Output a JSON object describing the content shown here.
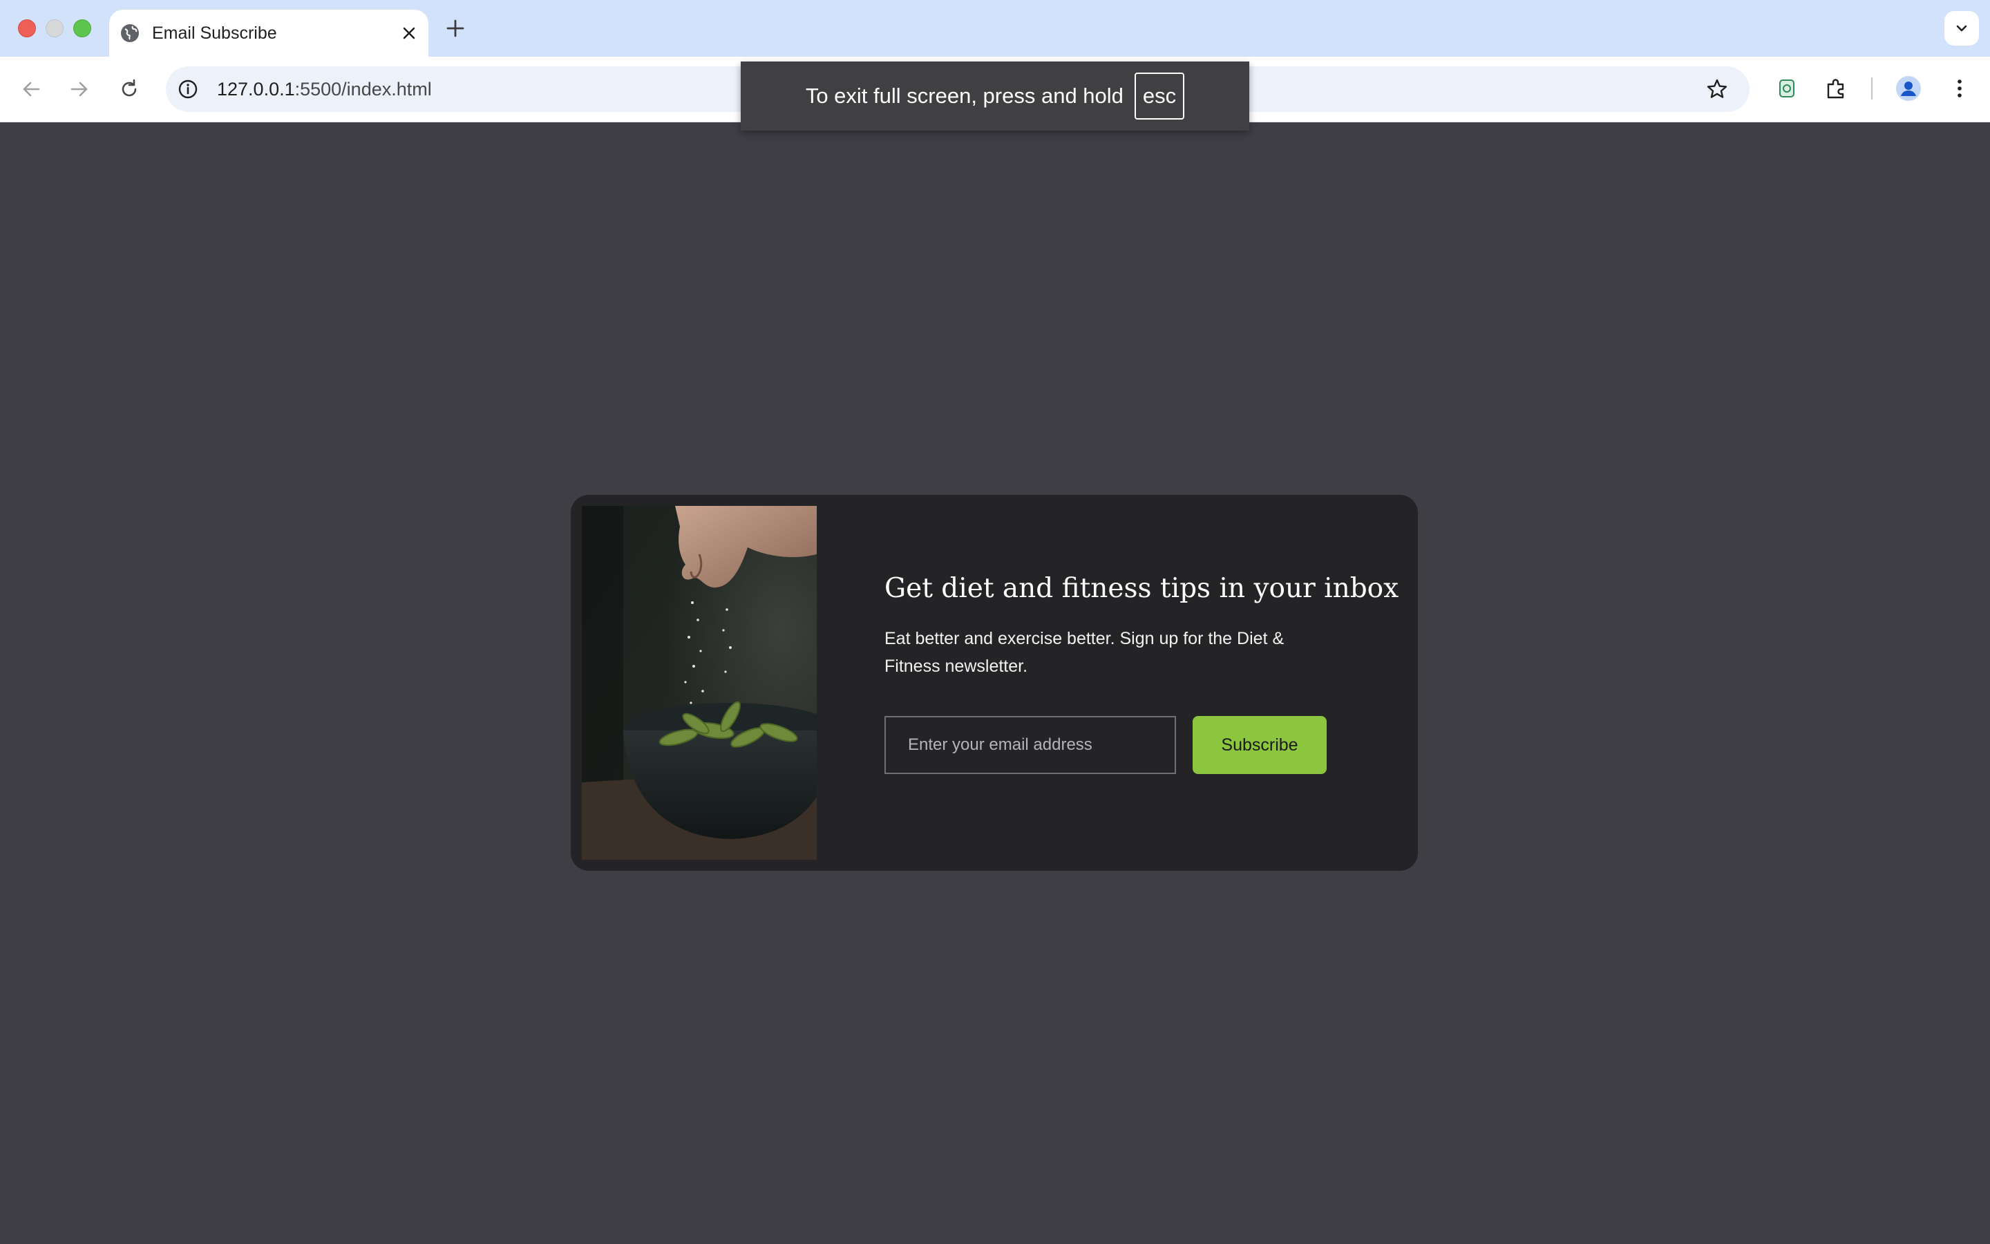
{
  "browser": {
    "tab": {
      "title": "Email Subscribe"
    },
    "address_bar": {
      "host": "127.0.0.1",
      "path": ":5500/index.html"
    }
  },
  "fullscreen_notice": {
    "text": "To exit full screen, press and hold",
    "key": "esc"
  },
  "signup_card": {
    "heading": "Get diet and fitness tips in your inbox",
    "description": "Eat better and exercise better. Sign up for the Diet & Fitness newsletter.",
    "email_placeholder": "Enter your email address",
    "email_value": "",
    "button_label": "Subscribe",
    "image_icon": "food-photo"
  },
  "colors": {
    "page_background": "#3f3e45",
    "card_background": "#242427",
    "accent": "#8cc63f",
    "tabstrip": "#d3e2fb"
  }
}
